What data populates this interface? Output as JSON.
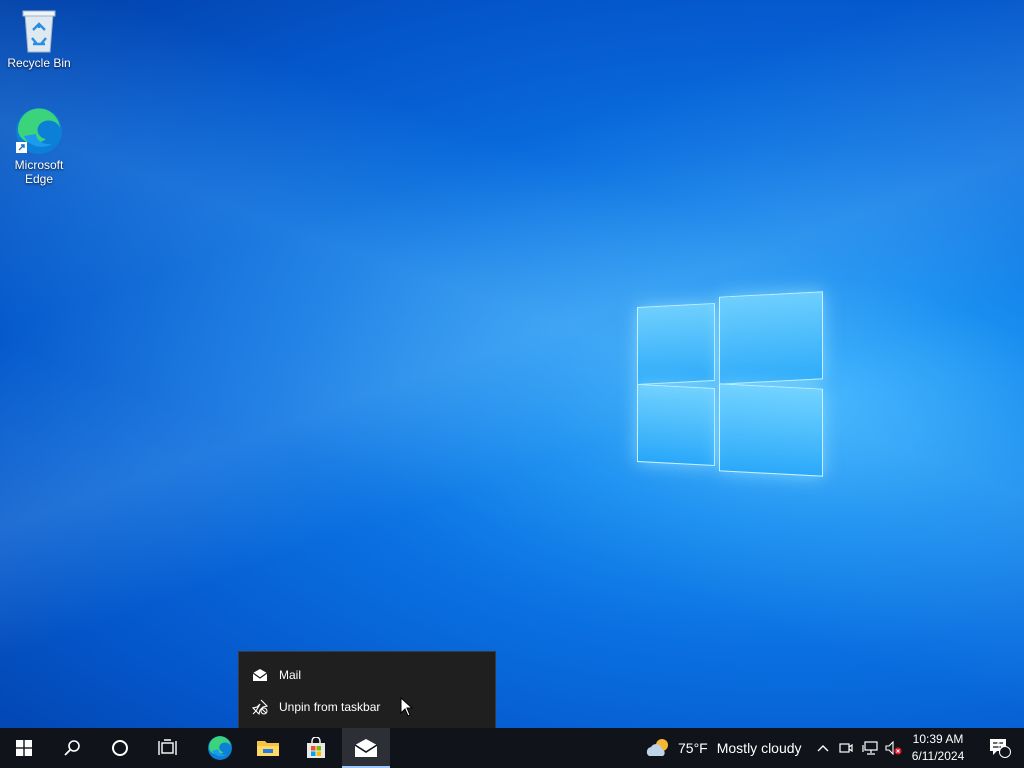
{
  "desktop": {
    "icons": [
      {
        "label": "Recycle Bin",
        "icon": "recycle-bin-icon"
      },
      {
        "label": "Microsoft\nEdge",
        "icon": "edge-icon"
      }
    ]
  },
  "context_menu": {
    "items": [
      {
        "label": "Mail",
        "icon": "mail-icon"
      },
      {
        "label": "Unpin from taskbar",
        "icon": "unpin-icon"
      }
    ]
  },
  "taskbar": {
    "buttons": [
      {
        "name": "start",
        "icon": "windows-start-icon"
      },
      {
        "name": "search",
        "icon": "search-icon"
      },
      {
        "name": "cortana",
        "icon": "cortana-circle-icon"
      },
      {
        "name": "task-view",
        "icon": "task-view-icon"
      },
      {
        "name": "edge",
        "icon": "edge-icon"
      },
      {
        "name": "file-explorer",
        "icon": "folder-icon"
      },
      {
        "name": "store",
        "icon": "store-bag-icon"
      },
      {
        "name": "mail",
        "icon": "mail-icon",
        "active": true
      }
    ],
    "weather": {
      "temperature": "75°F",
      "condition": "Mostly cloudy",
      "icon": "partly-cloudy-icon"
    },
    "tray_icons": [
      "chevron-up-icon",
      "meet-now-icon",
      "network-icon",
      "volume-muted-icon"
    ],
    "clock": {
      "time": "10:39 AM",
      "date": "6/11/2024"
    },
    "notifications": {
      "count": "1",
      "icon": "action-center-icon"
    }
  },
  "colors": {
    "taskbar_bg": "#10131a",
    "menu_bg": "#1f1f1f",
    "accent": "#0a6fe0"
  }
}
